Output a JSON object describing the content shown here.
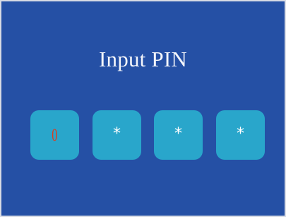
{
  "screen": {
    "title": "Input PIN",
    "background_color": "#2550a5",
    "slot_color": "#29a6cb",
    "active_digit_color": "#dd3b1d"
  },
  "pin": {
    "slots": [
      {
        "value": "0",
        "state": "active"
      },
      {
        "value": "*",
        "state": "masked"
      },
      {
        "value": "*",
        "state": "masked"
      },
      {
        "value": "*",
        "state": "masked"
      }
    ]
  }
}
